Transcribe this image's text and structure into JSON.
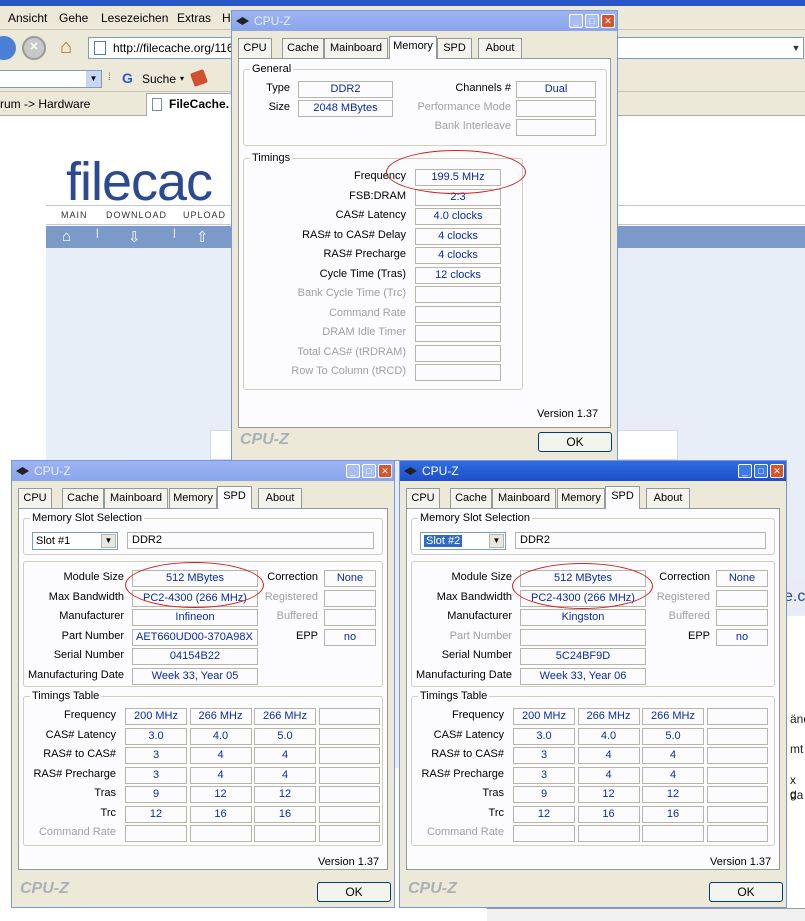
{
  "browser": {
    "menu": [
      "Ansicht",
      "Gehe",
      "Lesezeichen",
      "Extras",
      "H"
    ],
    "url": "http://filecache.org/116",
    "search_label": "Suche",
    "tab_breadcrumb": "rum -> Hardware",
    "active_tab": "FileCache.",
    "site_logo": "filecac",
    "site_nav": [
      "MAIN",
      "DOWNLOAD",
      "UPLOAD"
    ],
    "right_fragments": [
      "e.c",
      "änd",
      "mt",
      "x g",
      "da"
    ]
  },
  "memory_window": {
    "title": "CPU-Z",
    "tabs": [
      "CPU",
      "Cache",
      "Mainboard",
      "Memory",
      "SPD",
      "About"
    ],
    "active_tab": "Memory",
    "general_title": "General",
    "type_label": "Type",
    "type_value": "DDR2",
    "size_label": "Size",
    "size_value": "2048 MBytes",
    "channels_label": "Channels #",
    "channels_value": "Dual",
    "perf_mode_label": "Performance Mode",
    "bank_interleave_label": "Bank Interleave",
    "timings_title": "Timings",
    "timings": [
      {
        "label": "Frequency",
        "value": "199.5 MHz",
        "enabled": true
      },
      {
        "label": "FSB:DRAM",
        "value": "2:3",
        "enabled": true
      },
      {
        "label": "CAS# Latency",
        "value": "4.0 clocks",
        "enabled": true
      },
      {
        "label": "RAS# to CAS# Delay",
        "value": "4 clocks",
        "enabled": true
      },
      {
        "label": "RAS# Precharge",
        "value": "4 clocks",
        "enabled": true
      },
      {
        "label": "Cycle Time (Tras)",
        "value": "12 clocks",
        "enabled": true
      },
      {
        "label": "Bank Cycle Time (Trc)",
        "value": "",
        "enabled": false
      },
      {
        "label": "Command Rate",
        "value": "",
        "enabled": false
      },
      {
        "label": "DRAM Idle Timer",
        "value": "",
        "enabled": false
      },
      {
        "label": "Total CAS# (tRDRAM)",
        "value": "",
        "enabled": false
      },
      {
        "label": "Row To Column (tRCD)",
        "value": "",
        "enabled": false
      }
    ],
    "version": "Version 1.37",
    "brand": "CPU-Z",
    "ok": "OK"
  },
  "spd_windows": [
    {
      "title": "CPU-Z",
      "tabs": [
        "CPU",
        "Cache",
        "Mainboard",
        "Memory",
        "SPD",
        "About"
      ],
      "active_tab": "SPD",
      "slot_group_title": "Memory Slot Selection",
      "slot": "Slot #1",
      "slot_type": "DDR2",
      "module_size_label": "Module Size",
      "module_size": "512 MBytes",
      "max_bw_label": "Max Bandwidth",
      "max_bw": "PC2-4300 (266 MHz)",
      "manufacturer_label": "Manufacturer",
      "manufacturer": "Infineon",
      "part_label": "Part Number",
      "part_number": "AET660UD00-370A98X",
      "serial_label": "Serial Number",
      "serial_number": "04154B22",
      "mfg_date_label": "Manufacturing Date",
      "mfg_date": "Week 33, Year 05",
      "correction_label": "Correction",
      "correction": "None",
      "registered_label": "Registered",
      "buffered_label": "Buffered",
      "epp_label": "EPP",
      "epp": "no",
      "timings_title": "Timings Table",
      "rows": [
        {
          "label": "Frequency",
          "values": [
            "200 MHz",
            "266 MHz",
            "266 MHz",
            ""
          ],
          "enabled": true
        },
        {
          "label": "CAS# Latency",
          "values": [
            "3.0",
            "4.0",
            "5.0",
            ""
          ],
          "enabled": true
        },
        {
          "label": "RAS# to CAS#",
          "values": [
            "3",
            "4",
            "4",
            ""
          ],
          "enabled": true
        },
        {
          "label": "RAS# Precharge",
          "values": [
            "3",
            "4",
            "4",
            ""
          ],
          "enabled": true
        },
        {
          "label": "Tras",
          "values": [
            "9",
            "12",
            "12",
            ""
          ],
          "enabled": true
        },
        {
          "label": "Trc",
          "values": [
            "12",
            "16",
            "16",
            ""
          ],
          "enabled": true
        },
        {
          "label": "Command Rate",
          "values": [
            "",
            "",
            "",
            ""
          ],
          "enabled": false
        }
      ],
      "version": "Version 1.37",
      "brand": "CPU-Z",
      "ok": "OK"
    },
    {
      "title": "CPU-Z",
      "tabs": [
        "CPU",
        "Cache",
        "Mainboard",
        "Memory",
        "SPD",
        "About"
      ],
      "active_tab": "SPD",
      "slot_group_title": "Memory Slot Selection",
      "slot": "Slot #2",
      "slot_type": "DDR2",
      "module_size_label": "Module Size",
      "module_size": "512 MBytes",
      "max_bw_label": "Max Bandwidth",
      "max_bw": "PC2-4300 (266 MHz)",
      "manufacturer_label": "Manufacturer",
      "manufacturer": "Kingston",
      "part_label": "Part Number",
      "part_number": "",
      "serial_label": "Serial Number",
      "serial_number": "5C24BF9D",
      "mfg_date_label": "Manufacturing Date",
      "mfg_date": "Week 33, Year 06",
      "correction_label": "Correction",
      "correction": "None",
      "registered_label": "Registered",
      "buffered_label": "Buffered",
      "epp_label": "EPP",
      "epp": "no",
      "timings_title": "Timings Table",
      "rows": [
        {
          "label": "Frequency",
          "values": [
            "200 MHz",
            "266 MHz",
            "266 MHz",
            ""
          ],
          "enabled": true
        },
        {
          "label": "CAS# Latency",
          "values": [
            "3.0",
            "4.0",
            "5.0",
            ""
          ],
          "enabled": true
        },
        {
          "label": "RAS# to CAS#",
          "values": [
            "3",
            "4",
            "4",
            ""
          ],
          "enabled": true
        },
        {
          "label": "RAS# Precharge",
          "values": [
            "3",
            "4",
            "4",
            ""
          ],
          "enabled": true
        },
        {
          "label": "Tras",
          "values": [
            "9",
            "12",
            "12",
            ""
          ],
          "enabled": true
        },
        {
          "label": "Trc",
          "values": [
            "12",
            "16",
            "16",
            ""
          ],
          "enabled": true
        },
        {
          "label": "Command Rate",
          "values": [
            "",
            "",
            "",
            ""
          ],
          "enabled": false
        }
      ],
      "version": "Version 1.37",
      "brand": "CPU-Z",
      "ok": "OK"
    }
  ]
}
